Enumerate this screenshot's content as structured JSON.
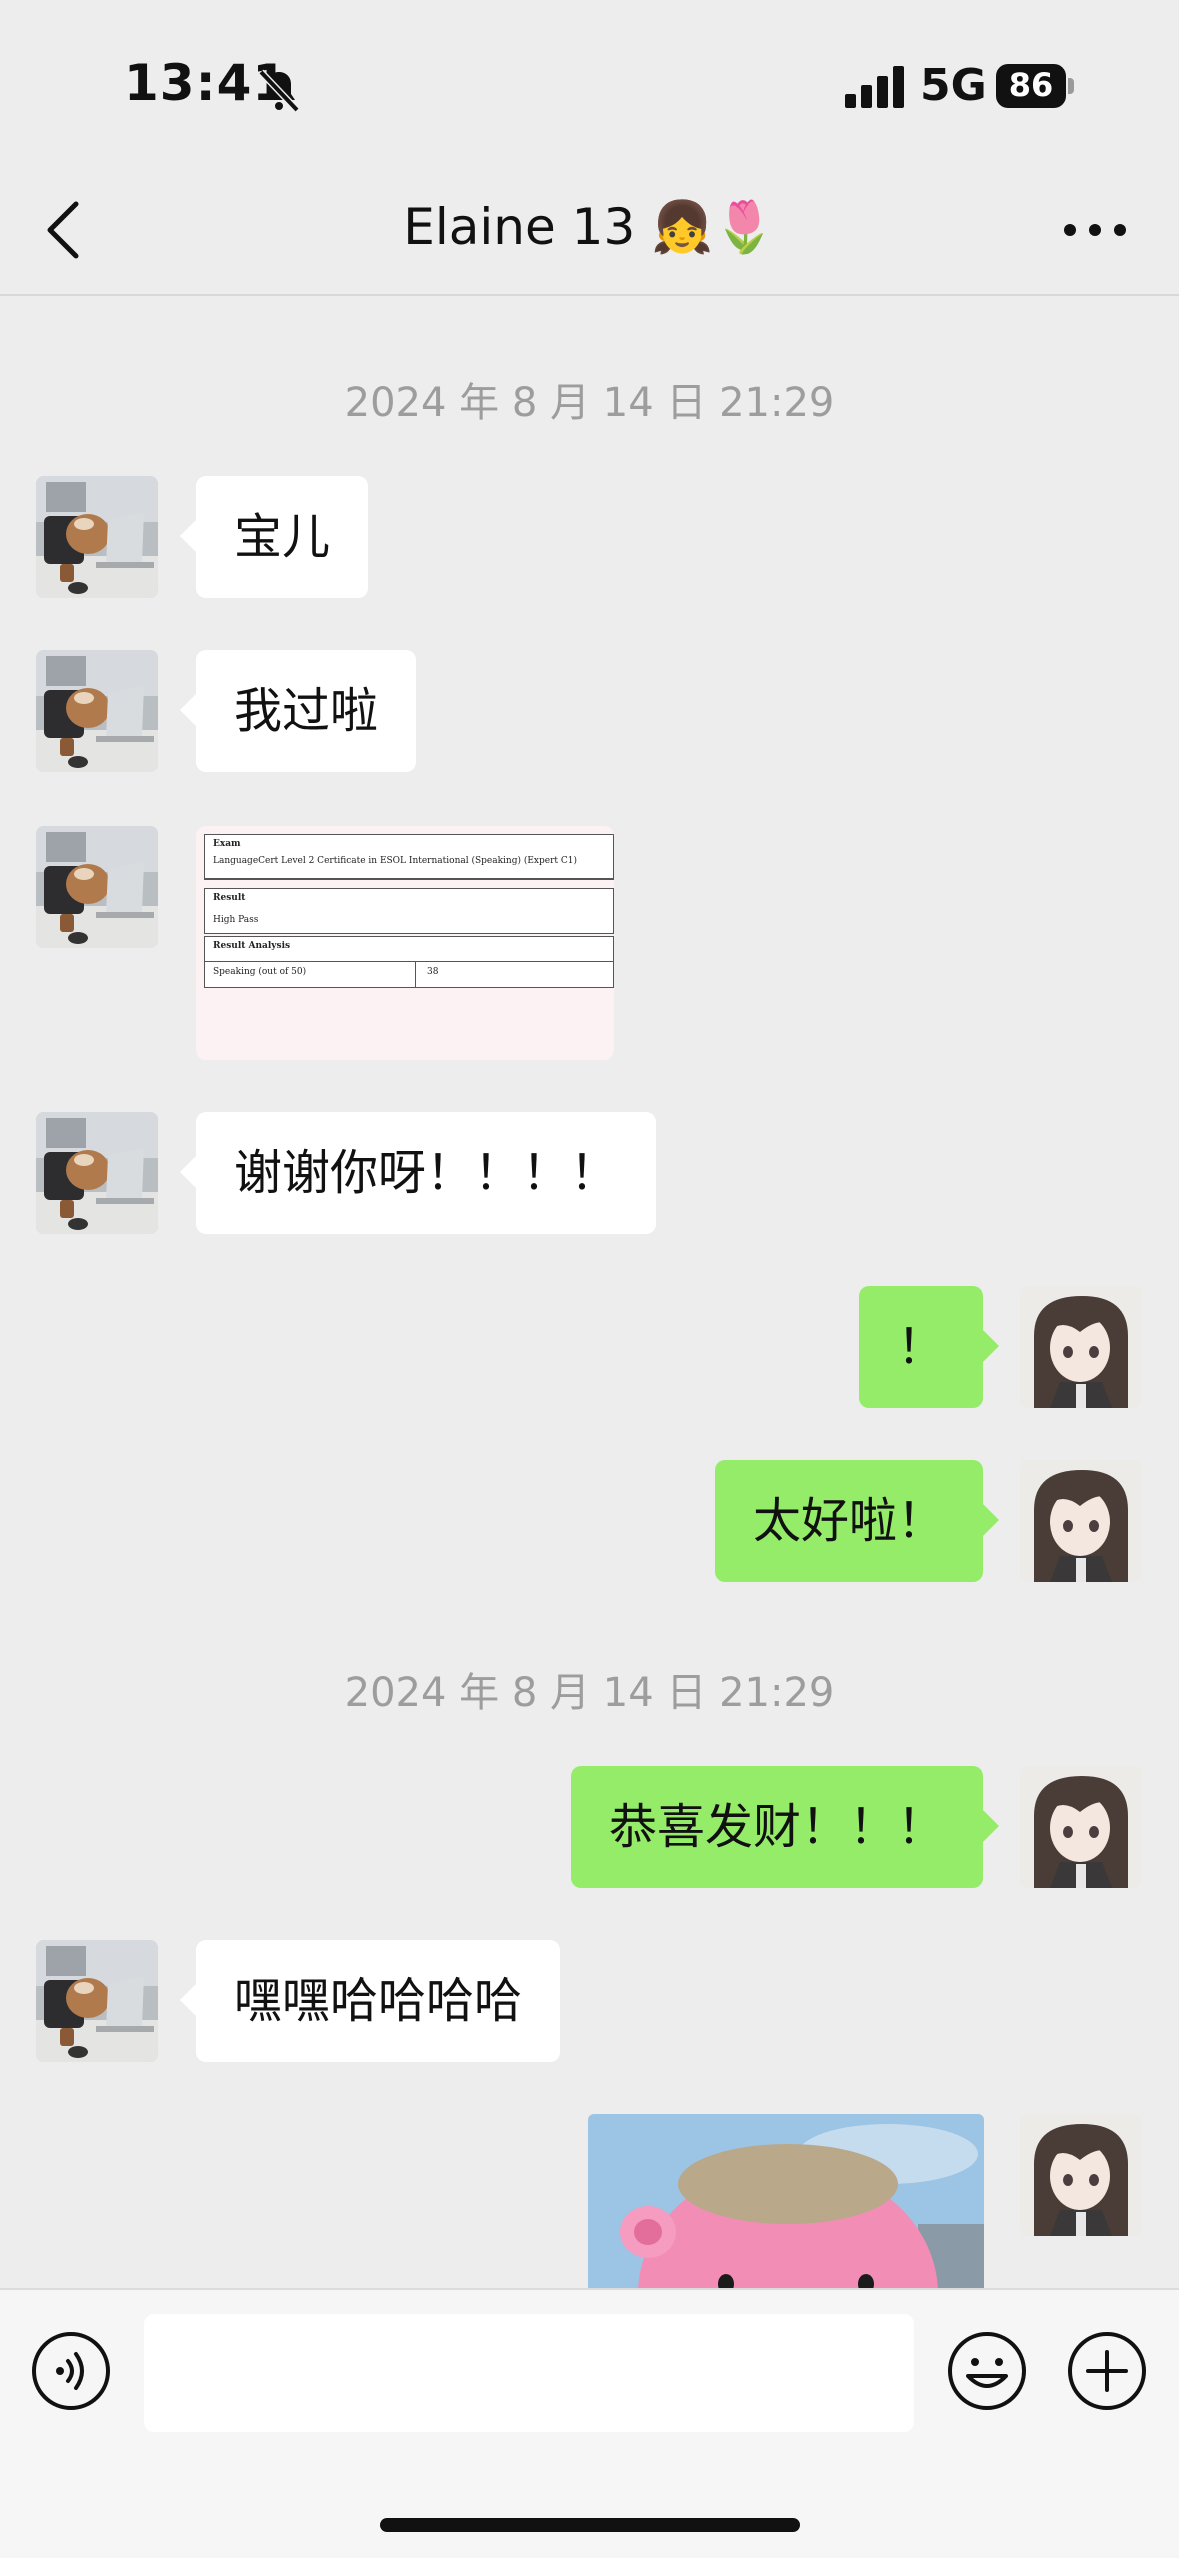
{
  "status_bar": {
    "time": "13:41",
    "network": "5G",
    "battery": "86"
  },
  "nav": {
    "title": "Elaine 13 👧🌷"
  },
  "messages": [
    {
      "type": "timestamp",
      "text": "2024 年 8 月 14 日 21:29"
    },
    {
      "type": "in",
      "text": "宝儿"
    },
    {
      "type": "in",
      "text": "我过啦"
    },
    {
      "type": "in-image",
      "doc": {
        "exam_heading": "Exam",
        "exam_value": "LanguageCert Level 2 Certificate in ESOL International (Speaking) (Expert C1)",
        "result_heading": "Result",
        "result_value": "High Pass",
        "analysis_heading": "Result Analysis",
        "analysis_label": "Speaking (out of 50)",
        "analysis_value": "38"
      }
    },
    {
      "type": "in",
      "text": "谢谢你呀！！！！"
    },
    {
      "type": "out",
      "text": "！"
    },
    {
      "type": "out",
      "text": "太好啦！"
    },
    {
      "type": "timestamp",
      "text": "2024 年 8 月 14 日 21:29"
    },
    {
      "type": "out",
      "text": "恭喜发财！！！"
    },
    {
      "type": "in",
      "text": "嘿嘿哈哈哈哈"
    },
    {
      "type": "out-sticker"
    }
  ],
  "colors": {
    "out_bubble": "#95ec69",
    "in_bubble": "#ffffff",
    "background": "#ededed"
  },
  "icons": [
    "bell-slash-icon",
    "signal-icon",
    "back-chevron-icon",
    "more-icon",
    "voice-icon",
    "emoji-icon",
    "plus-icon"
  ]
}
